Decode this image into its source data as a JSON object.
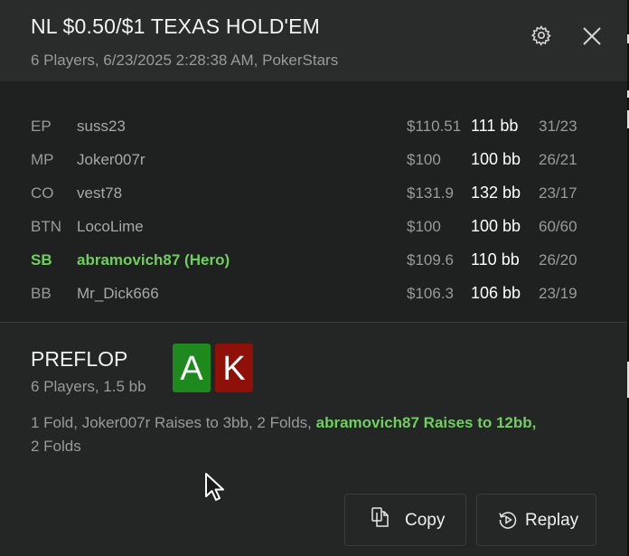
{
  "header": {
    "title": "NL $0.50/$1 TEXAS HOLD'EM",
    "subtitle": "6 Players, 6/23/2025 2:28:38 AM, PokerStars"
  },
  "players": [
    {
      "pos": "EP",
      "name": "suss23",
      "stack": "$110.51",
      "bb": "111 bb",
      "stat": "31/23"
    },
    {
      "pos": "MP",
      "name": "Joker007r",
      "stack": "$100",
      "bb": "100 bb",
      "stat": "26/21"
    },
    {
      "pos": "CO",
      "name": "vest78",
      "stack": "$131.9",
      "bb": "132 bb",
      "stat": "23/17"
    },
    {
      "pos": "BTN",
      "name": "LocoLime",
      "stack": "$100",
      "bb": "100 bb",
      "stat": "60/60"
    },
    {
      "pos": "SB",
      "name": "abramovich87 (Hero)",
      "stack": "$109.6",
      "bb": "110 bb",
      "stat": "26/20",
      "hero": true
    },
    {
      "pos": "BB",
      "name": "Mr_Dick666",
      "stack": "$106.3",
      "bb": "106 bb",
      "stat": "23/19"
    }
  ],
  "preflop": {
    "street": "PREFLOP",
    "summary": "6 Players, 1.5 bb",
    "cards": [
      {
        "rank": "A",
        "suit_color": "#1e8a1e"
      },
      {
        "rank": "K",
        "suit_color": "#8e1008"
      }
    ],
    "actions_part1": "1 Fold, Joker007r Raises to 3bb, 2 Folds, ",
    "actions_hero": "abramovich87 Raises to 12bb,",
    "actions_part2": "2 Folds"
  },
  "buttons": {
    "copy_label": "Copy",
    "replay_label": "Replay"
  },
  "icons": {
    "gear": "gear-icon",
    "close": "close-icon",
    "copy": "copy-icon",
    "replay": "replay-icon",
    "cursor": "mouse-cursor-icon"
  },
  "colors": {
    "hero": "#6fcf5f",
    "card_ace": "#1e8a1e",
    "card_king": "#8e1008"
  }
}
